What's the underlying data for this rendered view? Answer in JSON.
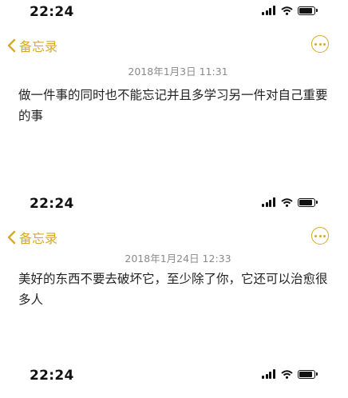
{
  "statusbar": {
    "time": "22:24"
  },
  "navbar": {
    "back_label": "备忘录"
  },
  "notes": [
    {
      "date": "2018年1月3日 11:31",
      "text": "做一件事的同时也不能忘记并且多学习另一件对自己重要的事"
    },
    {
      "date": "2018年1月24日 12:33",
      "text": "美好的东西不要去破坏它，至少除了你，它还可以治愈很多人"
    }
  ],
  "colors": {
    "accent": "#d6a928",
    "date_text": "#8a8a8a",
    "body_text": "#222222"
  },
  "icons": [
    "chevron-left-icon",
    "more-options-icon",
    "signal-icon",
    "wifi-icon",
    "battery-icon"
  ]
}
